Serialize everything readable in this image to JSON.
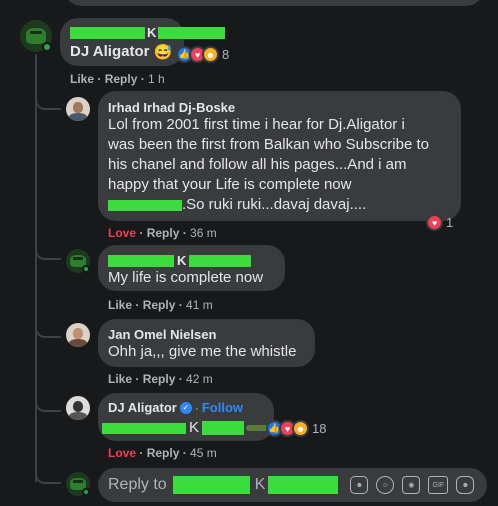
{
  "comments": [
    {
      "name_redacted": true,
      "name_middle": "K",
      "text": "DJ Aligator",
      "emoji": "😅",
      "reaction_count": "8",
      "actions": {
        "like": "Like",
        "reply": "Reply",
        "time": "1 h"
      }
    },
    {
      "name": "Irhad Irhad Dj-Boske",
      "text_lines": [
        "Lol from 2001 first time i hear for Dj.Aligator i",
        "was been the first from Balkan who Subscribe to",
        "his chanel and follow all his pages...And i am",
        "happy that your Life is complete now",
        ".So ruki ruki...davaj davaj...."
      ],
      "reaction_count": "1",
      "actions": {
        "like": "Love",
        "reply": "Reply",
        "time": "36 m"
      }
    },
    {
      "name_redacted": true,
      "name_middle": "K",
      "text": "My life is complete now",
      "actions": {
        "like": "Like",
        "reply": "Reply",
        "time": "41 m"
      }
    },
    {
      "name": "Jan Omel Nielsen",
      "text": "Ohh ja,,, give me the whistle",
      "actions": {
        "like": "Like",
        "reply": "Reply",
        "time": "42 m"
      }
    },
    {
      "name": "DJ Aligator",
      "follow": "Follow",
      "name_middle": "K",
      "reaction_count": "18",
      "actions": {
        "like": "Love",
        "reply": "Reply",
        "time": "45 m"
      }
    }
  ],
  "reply_box": {
    "prefix": "Reply to",
    "name_middle": "K"
  },
  "icons": [
    "sticker-icon",
    "emoji-icon",
    "camera-icon",
    "gif-icon",
    "sticker-face-icon"
  ],
  "colors": {
    "redaction": "#3cdc3c",
    "love": "#f33e58",
    "link": "#2d88ff",
    "online": "#31a24c"
  }
}
